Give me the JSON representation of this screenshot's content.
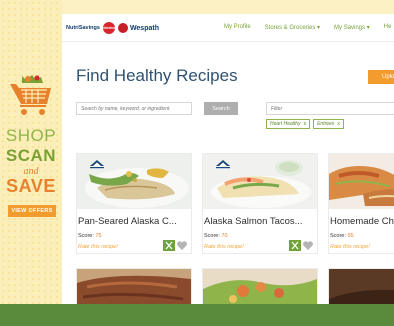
{
  "promo": {
    "shop": "SHOP",
    "scan": "SCAN",
    "and": "and",
    "save": "SAVE",
    "offers_button": "VIEW OFFERS"
  },
  "header": {
    "logo_text": "NutriSavings",
    "logo_badge": "unitedmed",
    "partner_logo": "Wespath",
    "nav": [
      "My Profile",
      "Stores & Groceries ▾",
      "My Savings ▾",
      "He"
    ]
  },
  "page": {
    "title": "Find Healthy Recipes",
    "upload_label": "Upload"
  },
  "search": {
    "placeholder": "Search by name, keyword, or ingredient",
    "button_label": "Search",
    "filter_placeholder": "Filter"
  },
  "filters": {
    "tags": [
      {
        "label": "Heart Healthy",
        "remove": "x"
      },
      {
        "label": "Entrees",
        "remove": "x"
      }
    ]
  },
  "recipes": [
    {
      "title": "Pan-Seared Alaska C...",
      "score_label": "Score:",
      "score": "75",
      "rate_label": "Rate this recipe!"
    },
    {
      "title": "Alaska Salmon Tacos...",
      "score_label": "Score:",
      "score": "70",
      "rate_label": "Rate this recipe!"
    },
    {
      "title": "Homemade Ch",
      "score_label": "Score:",
      "score": "65",
      "rate_label": "Rate this recipe!"
    }
  ],
  "colors": {
    "accent_orange": "#f29b2e",
    "nav_green": "#79a33a",
    "title_blue": "#2f5271",
    "footer_green": "#5a8a3c"
  }
}
